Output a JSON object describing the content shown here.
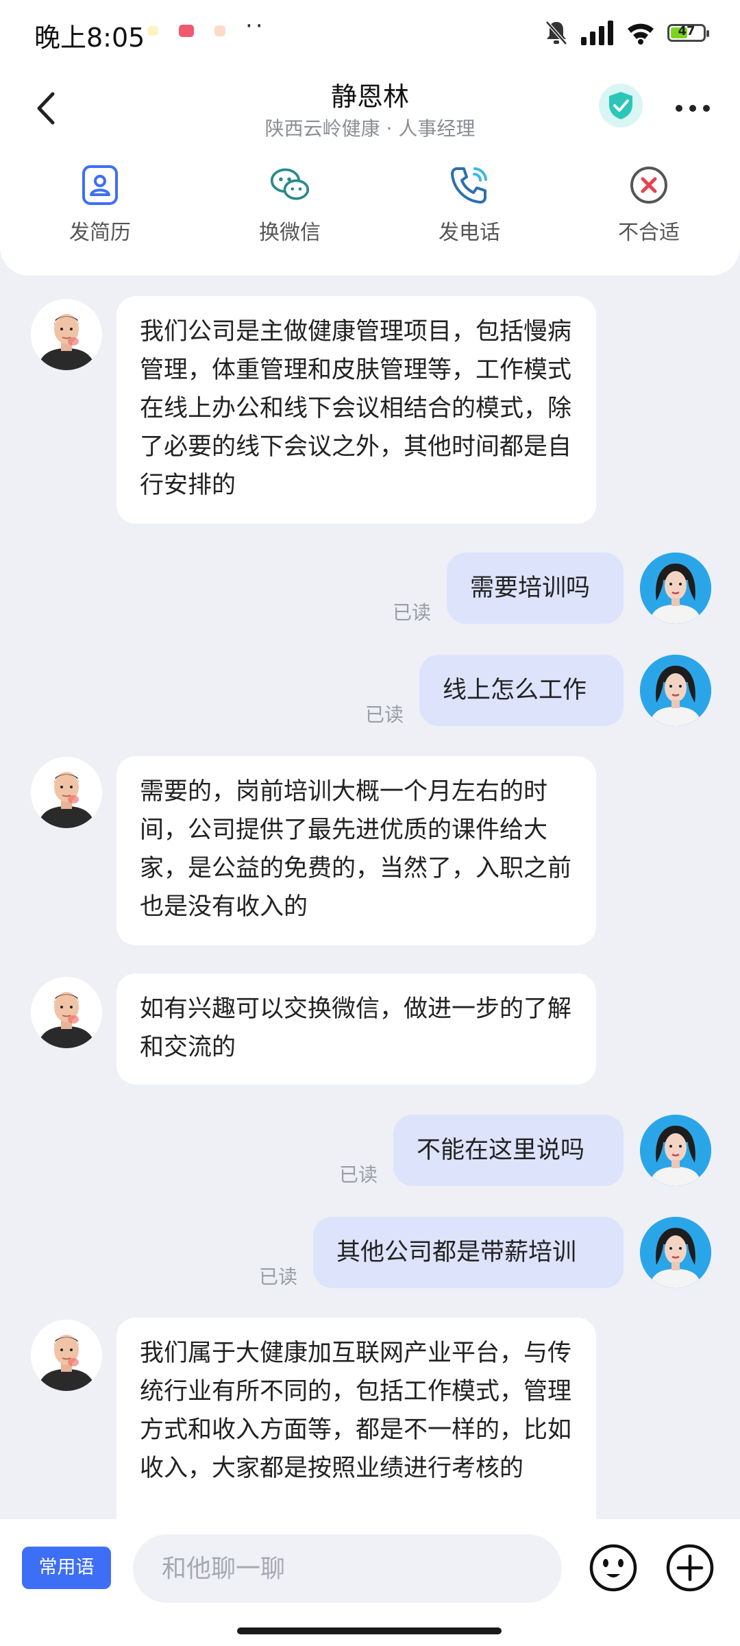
{
  "status_bar": {
    "time": "晚上8:05",
    "battery": "47"
  },
  "header": {
    "title": "静恩林",
    "subtitle": "陕西云岭健康 · 人事经理",
    "actions": [
      {
        "label": "发简历",
        "icon": "resume-icon"
      },
      {
        "label": "换微信",
        "icon": "wechat-icon"
      },
      {
        "label": "发电话",
        "icon": "phone-icon"
      },
      {
        "label": "不合适",
        "icon": "close-circle-icon"
      }
    ]
  },
  "messages": [
    {
      "side": "in",
      "text": "我们公司是主做健康管理项目，包括慢病管理，体重管理和皮肤管理等，工作模式在线上办公和线下会议相结合的模式，除了必要的线下会议之外，其他时间都是自行安排的"
    },
    {
      "side": "out",
      "text": "需要培训吗",
      "status": "已读"
    },
    {
      "side": "out",
      "text": "线上怎么工作",
      "status": "已读"
    },
    {
      "side": "in",
      "text": "需要的，岗前培训大概一个月左右的时间，公司提供了最先进优质的课件给大家，是公益的免费的，当然了，入职之前也是没有收入的"
    },
    {
      "side": "in",
      "text": "如有兴趣可以交换微信，做进一步的了解和交流的"
    },
    {
      "side": "out",
      "text": "不能在这里说吗",
      "status": "已读"
    },
    {
      "side": "out",
      "text": "其他公司都是带薪培训",
      "status": "已读"
    },
    {
      "side": "in",
      "text": "我们属于大健康加互联网产业平台，与传统行业有所不同的，包括工作模式，管理方式和收入方面等，都是不一样的，比如收入，大家都是按照业绩进行考核的"
    }
  ],
  "input_bar": {
    "phrases_label": "常用语",
    "placeholder": "和他聊一聊"
  },
  "colors": {
    "accent": "#3d6ef6",
    "out_bubble": "#dde3fb",
    "verify": "#2bc6b8",
    "decline": "#e8424f"
  }
}
